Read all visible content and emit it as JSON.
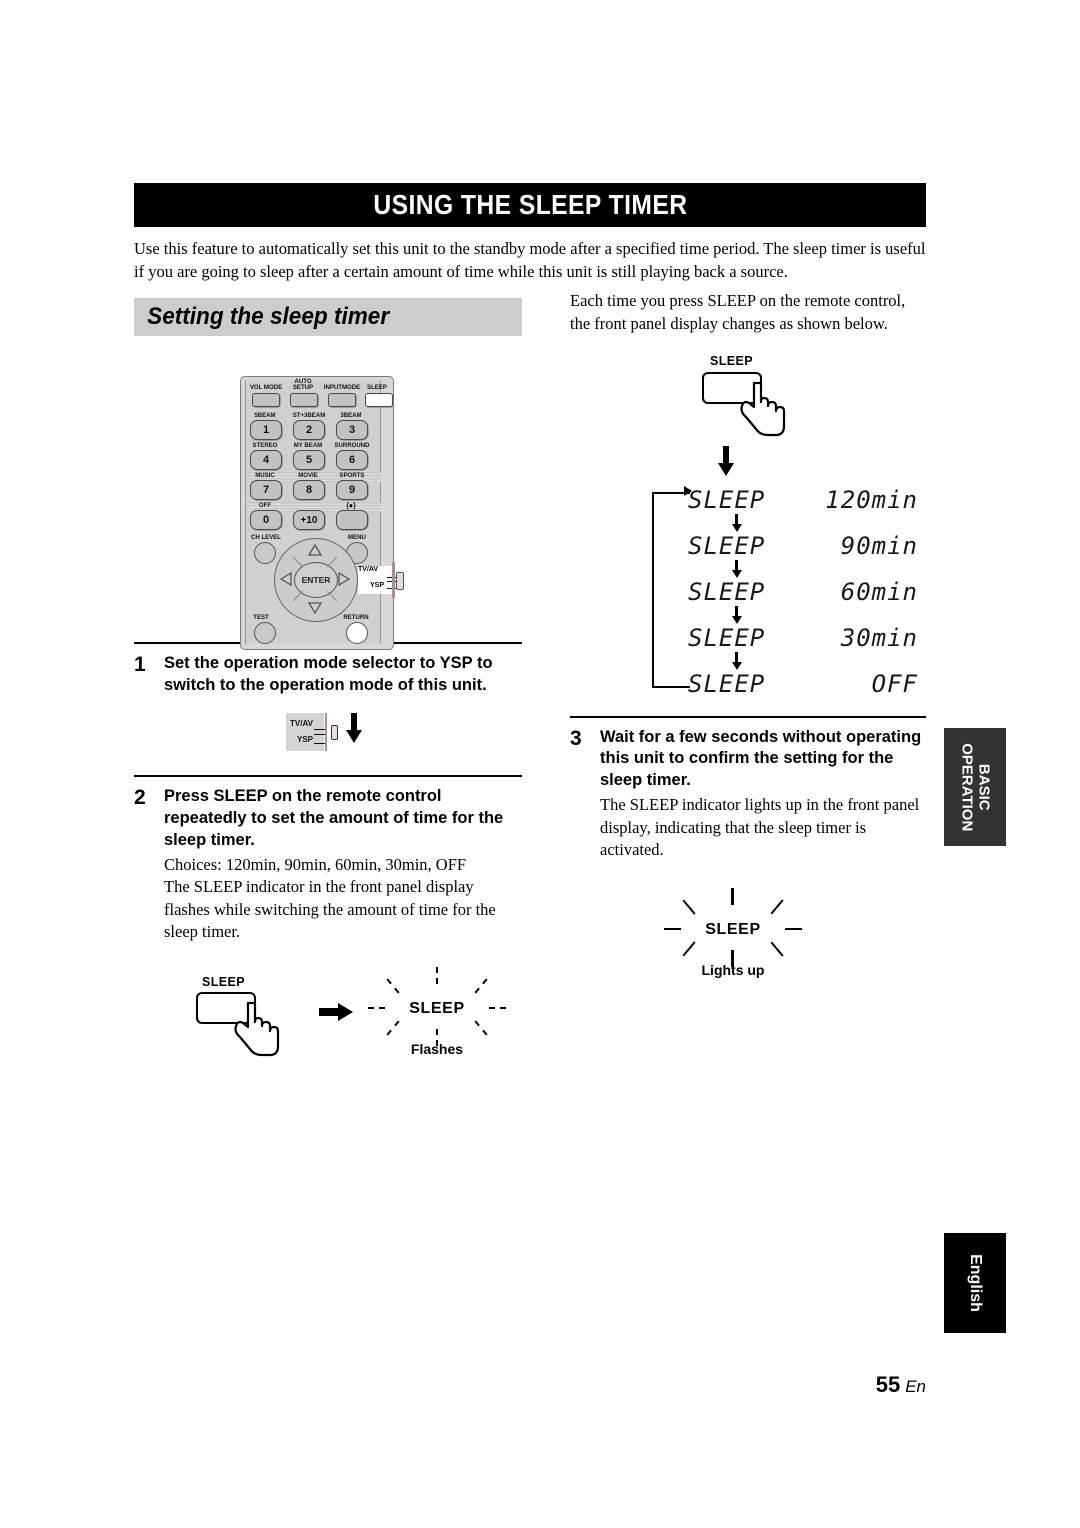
{
  "page": {
    "title": "USING THE SLEEP TIMER",
    "intro": "Use this feature to automatically set this unit to the standby mode after a specified time period. The sleep timer is useful if you are going to sleep after a certain amount of time while this unit is still playing back a source.",
    "page_number": "55",
    "page_lang_suffix": "En"
  },
  "section": {
    "heading": "Setting the sleep timer"
  },
  "right_column": {
    "intro": "Each time you press SLEEP on the remote control, the front panel display changes as shown below.",
    "key_figure": {
      "key_label": "SLEEP"
    }
  },
  "remote": {
    "row_top_labels": [
      "VOL MODE",
      "AUTO SETUP",
      "INPUTMODE",
      "SLEEP"
    ],
    "row_top_auto": "AUTO",
    "row_top_setup": "SETUP",
    "keys": [
      {
        "top_label": "5BEAM",
        "digit": "1"
      },
      {
        "top_label": "ST+3BEAM",
        "digit": "2"
      },
      {
        "top_label": "3BEAM",
        "digit": "3"
      },
      {
        "top_label": "STEREO",
        "digit": "4"
      },
      {
        "top_label": "MY BEAM",
        "digit": "5"
      },
      {
        "top_label": "SURROUND",
        "digit": "6"
      },
      {
        "top_label": "MUSIC",
        "digit": "7"
      },
      {
        "top_label": "MOVIE",
        "digit": "8"
      },
      {
        "top_label": "SPORTS",
        "digit": "9"
      },
      {
        "top_label": "OFF",
        "digit": "0"
      },
      {
        "top_label": "",
        "digit": "+10"
      },
      {
        "top_label": "(●)",
        "digit": ""
      }
    ],
    "ch_level": "CH LEVEL",
    "menu": "MENU",
    "test": "TEST",
    "return": "RETURN",
    "enter": "ENTER",
    "selector_tv": "TV/AV",
    "selector_ysp": "YSP"
  },
  "steps": [
    {
      "number": "1",
      "heading": "Set the operation mode selector to YSP to switch to the operation mode of this unit.",
      "body": ""
    },
    {
      "number": "2",
      "heading": "Press SLEEP on the remote control repeatedly to set the amount of time for the sleep timer.",
      "body": "Choices: 120min, 90min, 60min, 30min, OFF\nThe SLEEP indicator in the front panel display flashes while switching the amount of time for the sleep timer."
    },
    {
      "number": "3",
      "heading": "Wait for a few seconds without operating this unit to confirm the setting for the sleep timer.",
      "body": "The SLEEP indicator lights up in the front panel display, indicating that the sleep timer is activated."
    }
  ],
  "selector_figure": {
    "tv_label": "TV/AV",
    "ysp_label": "YSP"
  },
  "flashes_figure": {
    "key_label": "SLEEP",
    "indicator": "SLEEP",
    "caption": "Flashes"
  },
  "lights_up_figure": {
    "indicator": "SLEEP",
    "caption": "Lights up"
  },
  "sleep_sequence": {
    "label": "SLEEP",
    "steps": [
      {
        "label": "SLEEP",
        "value": "120min"
      },
      {
        "label": "SLEEP",
        "value": "90min"
      },
      {
        "label": "SLEEP",
        "value": "60min"
      },
      {
        "label": "SLEEP",
        "value": "30min"
      },
      {
        "label": "SLEEP",
        "value": "OFF"
      }
    ]
  },
  "side_tabs": {
    "basic_line1": "BASIC",
    "basic_line2": "OPERATION",
    "english": "English"
  }
}
